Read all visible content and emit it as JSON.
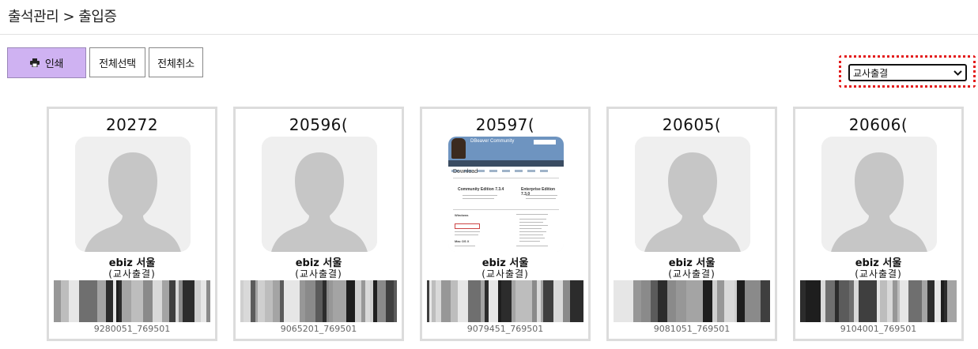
{
  "header": {
    "breadcrumb": "출석관리 > 출입증"
  },
  "toolbar": {
    "print_label": "인쇄",
    "select_all_label": "전체선택",
    "deselect_all_label": "전체취소",
    "print_icon": "printer-icon",
    "print_button_color": "#cfb2f2"
  },
  "filter": {
    "selected": "교사출결",
    "highlight_color": "#e31b1b"
  },
  "cards": [
    {
      "id": "20272",
      "name": "ebiz 서울",
      "type": "(교사출결)",
      "barcode": "9280051_769501",
      "photo": "default-avatar"
    },
    {
      "id": "20596(",
      "name": "ebiz 서울",
      "type": "(교사출결)",
      "barcode": "9065201_769501",
      "photo": "default-avatar"
    },
    {
      "id": "20597(",
      "name": "ebiz 서울",
      "type": "(교사출결)",
      "barcode": "9079451_769501",
      "photo": "website-screenshot"
    },
    {
      "id": "20605(",
      "name": "ebiz 서울",
      "type": "(교사출결)",
      "barcode": "9081051_769501",
      "photo": "default-avatar"
    },
    {
      "id": "20606(",
      "name": "ebiz 서울",
      "type": "(교사출결)",
      "barcode": "9104001_769501",
      "photo": "default-avatar"
    }
  ],
  "photo_screenshot": {
    "title": "DBeaver Community",
    "heading": "Download",
    "edition_left": "Community Edition 7.3.4",
    "edition_right": "Enterprise Edition 7.3.0",
    "os_windows": "Windows",
    "os_mac": "Mac OS X"
  }
}
